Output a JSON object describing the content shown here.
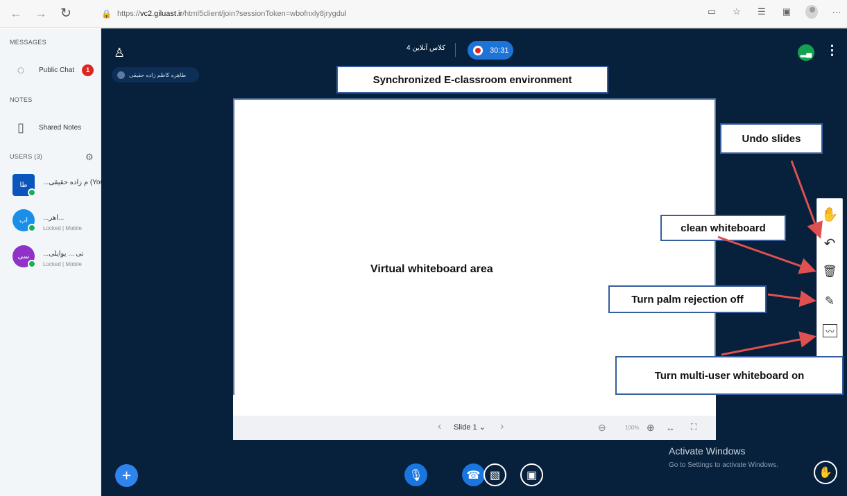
{
  "browser": {
    "back_icon": "back-arrow-icon",
    "forward_icon": "forward-arrow-icon",
    "reload_icon": "reload-icon",
    "url": "https://vc2.giluast.ir/html5client/join?sessionToken=wbofnxly8jrygdul",
    "url_prefix": "https://",
    "url_host": "vc2.giluast.ir",
    "url_path": "/html5client/join?sessionToken=wbofnxly8jrygdul",
    "more": "···"
  },
  "sidebar": {
    "messages_title": "MESSAGES",
    "public_chat": "Public Chat",
    "public_chat_badge": "1",
    "notes_title": "NOTES",
    "shared_notes": "Shared Notes",
    "users_title": "USERS (3)",
    "users": [
      {
        "avatar": "طا",
        "name": "...م زاده حقیقی (You)",
        "sub": ""
      },
      {
        "avatar": "اب",
        "name": "...اهر...",
        "sub": "Locked | Mobile"
      },
      {
        "avatar": "سی",
        "name": "...نی ... یوایلی",
        "sub": "Locked | Mobile"
      }
    ]
  },
  "main": {
    "presenter": "طاهره کاظم زاده حقیقی",
    "meeting_title": "کلاس آنلاین 4",
    "timer": "30:31",
    "connection_icon": "signal-bars-icon",
    "more_icon": "vertical-dots-icon"
  },
  "whiteboard": {
    "label": "Virtual whiteboard area"
  },
  "slide_controls": {
    "slide_label": "Slide 1",
    "zoom_label": "100%"
  },
  "callouts": {
    "synchronized": "Synchronized E-classroom environment",
    "undo": "Undo slides",
    "clean": "clean whiteboard",
    "palm": "Turn palm rejection off",
    "multiuser": "Turn multi-user whiteboard on"
  },
  "toolbar": {
    "hand": "hand-tool-icon",
    "undo": "undo-icon",
    "delete": "trash-icon",
    "palm": "palm-rejection-icon",
    "multiuser": "multi-user-whiteboard-icon"
  },
  "controls": {
    "plus": "+",
    "microphone": "microphone-icon",
    "phone": "phone-icon",
    "camera": "camera-off-icon",
    "screen": "screen-share-off-icon",
    "hand": "raise-hand-icon"
  },
  "activation": {
    "title": "Activate Windows",
    "subtitle": "Go to Settings to activate Windows."
  },
  "colors": {
    "main_bg": "#07203b",
    "sidebar_bg": "#f3f6f9",
    "accent_blue": "#1976df",
    "record_red": "#df2721",
    "annotation_arrow": "#e05050"
  }
}
